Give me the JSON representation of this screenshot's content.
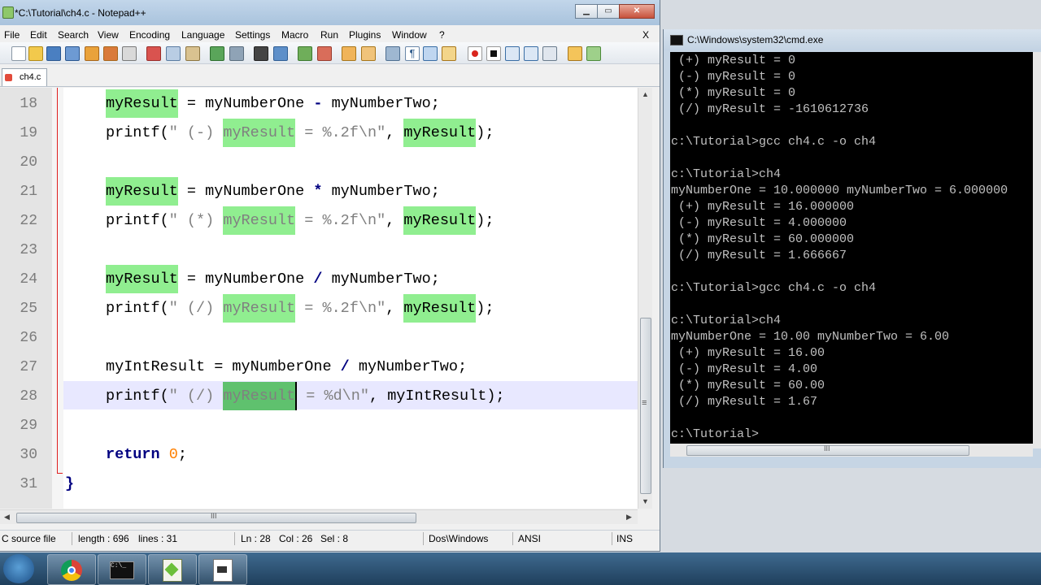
{
  "notepad": {
    "title": "*C:\\Tutorial\\ch4.c - Notepad++",
    "close_x": "X",
    "menu": [
      "File",
      "Edit",
      "Search",
      "View",
      "Encoding",
      "Language",
      "Settings",
      "Macro",
      "Run",
      "Plugins",
      "Window",
      "?"
    ],
    "tab_label": "ch4.c",
    "lines": [
      {
        "n": "18",
        "text": "myResult = myNumberOne - myNumberTwo;"
      },
      {
        "n": "19",
        "text": "printf(\" (-) myResult = %.2f\\n\", myResult);"
      },
      {
        "n": "20",
        "text": ""
      },
      {
        "n": "21",
        "text": "myResult = myNumberOne * myNumberTwo;"
      },
      {
        "n": "22",
        "text": "printf(\" (*) myResult = %.2f\\n\", myResult);"
      },
      {
        "n": "23",
        "text": ""
      },
      {
        "n": "24",
        "text": "myResult = myNumberOne / myNumberTwo;"
      },
      {
        "n": "25",
        "text": "printf(\" (/) myResult = %.2f\\n\", myResult);"
      },
      {
        "n": "26",
        "text": ""
      },
      {
        "n": "27",
        "text": "myIntResult = myNumberOne / myNumberTwo;"
      },
      {
        "n": "28",
        "text": "printf(\" (/) myResult = %d\\n\", myIntResult);"
      },
      {
        "n": "29",
        "text": ""
      },
      {
        "n": "30",
        "text": "return 0;"
      },
      {
        "n": "31",
        "text": "}"
      }
    ],
    "code": {
      "l18": {
        "a": "myResult",
        "b": " = myNumberOne ",
        "op": "-",
        "c": " myNumberTwo;"
      },
      "l19": {
        "fn": "printf(",
        "s1": "\" (-) ",
        "hl": "myResult",
        "s2": " = %.2f\\n\"",
        "c": ", ",
        "v": "myResult",
        "e": ");"
      },
      "l21": {
        "a": "myResult",
        "b": " = myNumberOne ",
        "op": "*",
        "c": " myNumberTwo;"
      },
      "l22": {
        "fn": "printf(",
        "s1": "\" (*) ",
        "hl": "myResult",
        "s2": " = %.2f\\n\"",
        "c": ", ",
        "v": "myResult",
        "e": ");"
      },
      "l24": {
        "a": "myResult",
        "b": " = myNumberOne ",
        "op": "/",
        "c": " myNumberTwo;"
      },
      "l25": {
        "fn": "printf(",
        "s1": "\" (/) ",
        "hl": "myResult",
        "s2": " = %.2f\\n\"",
        "c": ", ",
        "v": "myResult",
        "e": ");"
      },
      "l27": {
        "a": "myIntResult = myNumberOne ",
        "op": "/",
        "c": " myNumberTwo;"
      },
      "l28": {
        "fn": "printf(",
        "s1": "\" (/) ",
        "hl": "myResult",
        "s2": " = %d\\n\"",
        "c": ", myIntResult);"
      },
      "l30": {
        "kw": "return",
        "sp": " ",
        "num": "0",
        "e": ";"
      },
      "l31": {
        "t": "}"
      }
    },
    "status": {
      "type": "C source file",
      "length": "length : 696",
      "lines": "lines : 31",
      "ln": "Ln : 28",
      "col": "Col : 26",
      "sel": "Sel : 8",
      "eol": "Dos\\Windows",
      "enc": "ANSI",
      "mode": "INS"
    },
    "hscroll_grip": "III",
    "vscroll_grip": "≡"
  },
  "cmd": {
    "title": "C:\\Windows\\system32\\cmd.exe",
    "lines": [
      " (+) myResult = 0",
      " (-) myResult = 0",
      " (*) myResult = 0",
      " (/) myResult = -1610612736",
      "",
      "c:\\Tutorial>gcc ch4.c -o ch4",
      "",
      "c:\\Tutorial>ch4",
      "myNumberOne = 10.000000 myNumberTwo = 6.000000",
      " (+) myResult = 16.000000",
      " (-) myResult = 4.000000",
      " (*) myResult = 60.000000",
      " (/) myResult = 1.666667",
      "",
      "c:\\Tutorial>gcc ch4.c -o ch4",
      "",
      "c:\\Tutorial>ch4",
      "myNumberOne = 10.00 myNumberTwo = 6.00",
      " (+) myResult = 16.00",
      " (-) myResult = 4.00",
      " (*) myResult = 60.00",
      " (/) myResult = 1.67",
      "",
      "c:\\Tutorial>"
    ],
    "hscroll_grip": "III"
  },
  "taskbar": {
    "items": [
      "start-button",
      "chrome",
      "cmd",
      "notepad++",
      "document"
    ],
    "cmd_icon_text": "C:\\_"
  },
  "colors": {
    "highlight": "#90ee90",
    "keyword": "#000080",
    "string": "#808080",
    "number": "#ff8000",
    "fold_line": "#e02020"
  }
}
